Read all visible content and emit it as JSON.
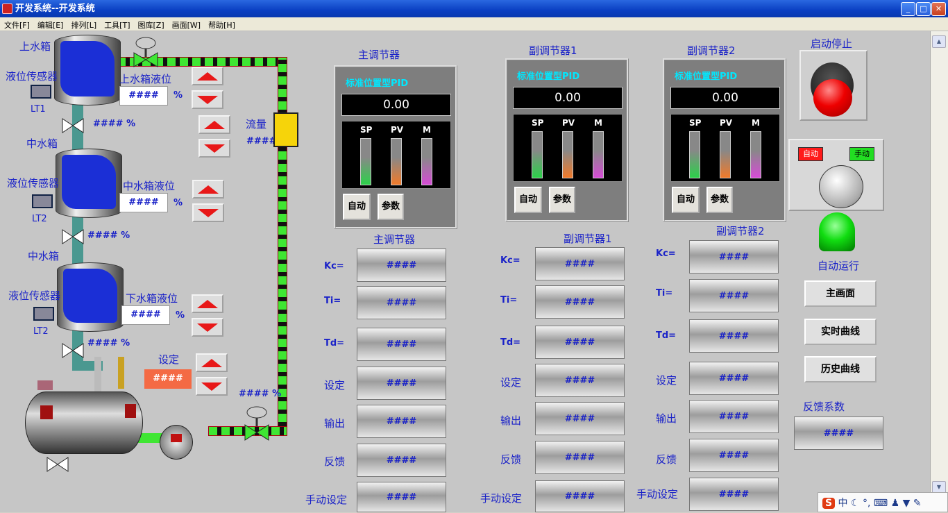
{
  "window": {
    "title": "开发系统--开发系统",
    "controls": [
      "_",
      "□",
      "✕"
    ]
  },
  "menu": [
    "文件[F]",
    "编辑[E]",
    "排列[L]",
    "工具[T]",
    "图库[Z]",
    "画面[W]",
    "帮助[H]"
  ],
  "process": {
    "upper_tank": "上水箱",
    "middle_tank": "中水箱",
    "middle_tank_2": "中水箱",
    "sensor": "液位传感器",
    "lt1": "LT1",
    "lt2": "LT2",
    "lt3": "LT2",
    "upper_level_label": "上水箱液位",
    "middle_level_label": "中水箱液位",
    "lower_level_label": "下水箱液位",
    "level_value": "####",
    "pct": "%",
    "valve_reading": "#### %",
    "flow_label": "流量",
    "flow_value": "####",
    "setpoint_label": "设定",
    "setpoint_value": "####",
    "pump_reading": "#### %"
  },
  "pid": {
    "title": "标准位置型PID",
    "output": "0.00",
    "sp": "SP",
    "pv": "PV",
    "m": "M",
    "auto": "自动",
    "param": "参数",
    "main_title": "主调节器",
    "sub1_title": "副调节器1",
    "sub2_title": "副调节器2"
  },
  "params": {
    "kc": "Kc=",
    "ti": "Ti=",
    "td": "Td=",
    "set": "设定",
    "out": "输出",
    "fb": "反馈",
    "manual": "手动设定",
    "value": "####"
  },
  "controls": {
    "start_stop": "启动停止",
    "auto_tag": "自动",
    "manual_tag": "手动",
    "auto_run": "自动运行",
    "main_screen": "主画面",
    "realtime": "实时曲线",
    "history": "历史曲线",
    "feedback_coef": "反馈系数",
    "feedback_value": "####"
  },
  "colors": {
    "accent": "#1a22c8",
    "alarm": "#e81818",
    "panel": "#7e7e7e"
  },
  "tray": {
    "s": "S",
    "ime": "中"
  }
}
